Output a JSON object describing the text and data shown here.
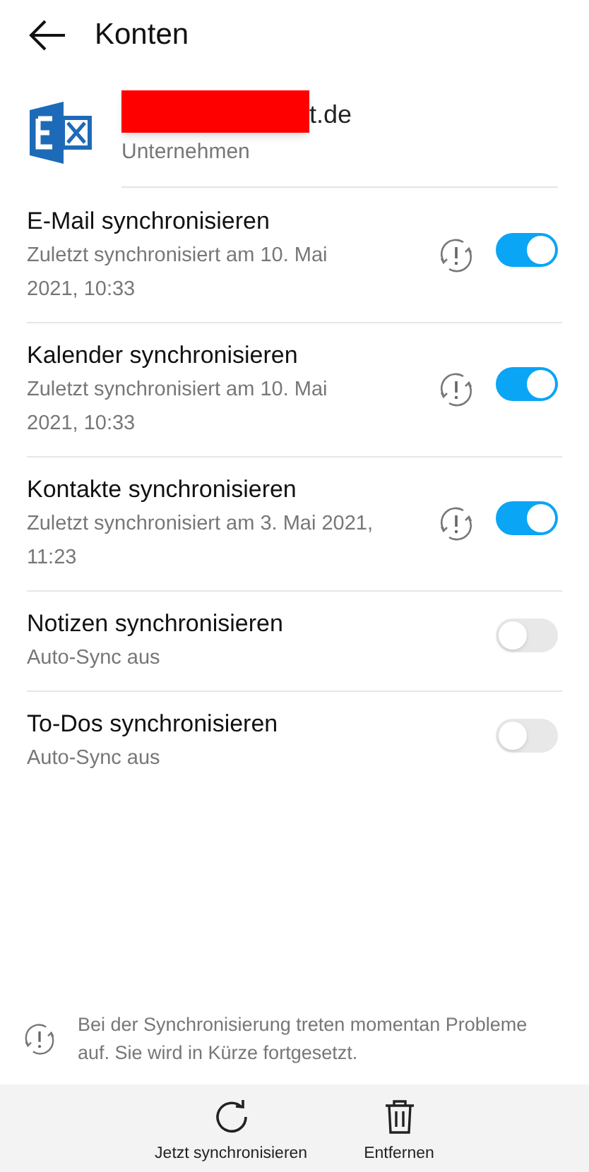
{
  "header": {
    "title": "Konten"
  },
  "account": {
    "redacted": true,
    "name": "t.de",
    "type": "Unternehmen"
  },
  "sync_items": [
    {
      "title": "E-Mail synchronisieren",
      "subtitle": "Zuletzt synchronisiert am 10. Mai 2021, 10:33",
      "warning": true,
      "on": true
    },
    {
      "title": "Kalender synchronisieren",
      "subtitle": "Zuletzt synchronisiert am 10. Mai 2021, 10:33",
      "warning": true,
      "on": true
    },
    {
      "title": "Kontakte synchronisieren",
      "subtitle": "Zuletzt synchronisiert am 3. Mai 2021, 11:23",
      "warning": true,
      "on": true
    },
    {
      "title": "Notizen synchronisieren",
      "subtitle": "Auto-Sync aus",
      "warning": false,
      "on": false
    },
    {
      "title": "To-Dos synchronisieren",
      "subtitle": "Auto-Sync aus",
      "warning": false,
      "on": false
    }
  ],
  "notice": "Bei der Synchronisierung treten momentan Probleme auf. Sie wird in Kürze fortgesetzt.",
  "actions": [
    {
      "kind": "sync",
      "label": "Jetzt synchronisieren"
    },
    {
      "kind": "delete",
      "label": "Entfernen"
    }
  ]
}
